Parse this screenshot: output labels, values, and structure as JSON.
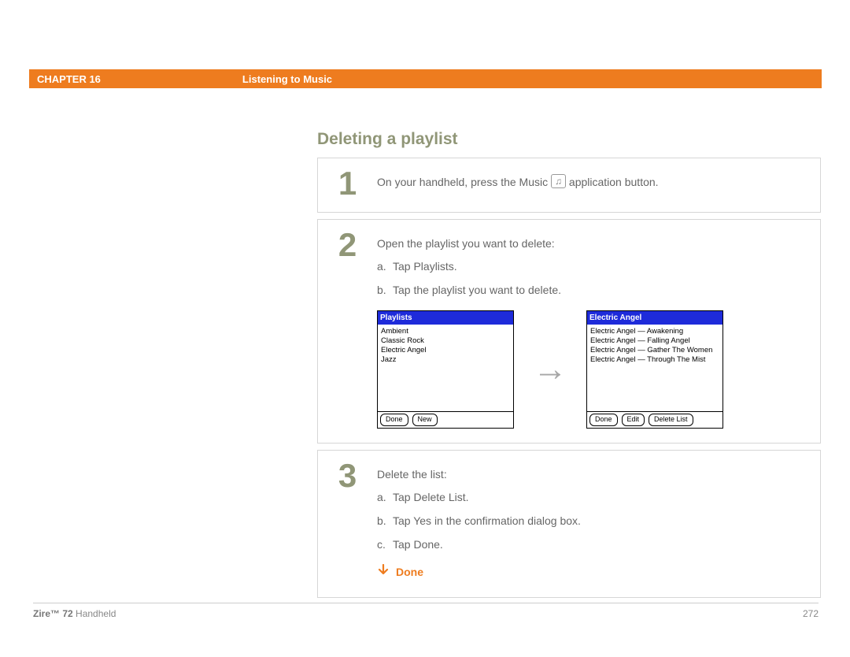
{
  "header": {
    "chapter": "CHAPTER 16",
    "title": "Listening to Music"
  },
  "section_title": "Deleting a playlist",
  "step1": {
    "num": "1",
    "text_before": "On your handheld, press the Music ",
    "text_after": " application button."
  },
  "step2": {
    "num": "2",
    "intro": "Open the playlist you want to delete:",
    "a": "Tap Playlists.",
    "b": "Tap the playlist you want to delete.",
    "screen1": {
      "title": "Playlists",
      "items": [
        "Ambient",
        "Classic Rock",
        "Electric Angel",
        "Jazz"
      ],
      "buttons": [
        "Done",
        "New"
      ]
    },
    "screen2": {
      "title": "Electric Angel",
      "items": [
        "Electric Angel — Awakening",
        "Electric Angel — Falling Angel",
        "Electric Angel — Gather The Women",
        "Electric Angel — Through The Mist"
      ],
      "buttons": [
        "Done",
        "Edit",
        "Delete List"
      ]
    }
  },
  "step3": {
    "num": "3",
    "intro": "Delete the list:",
    "a": "Tap Delete List.",
    "b": "Tap Yes in the confirmation dialog box.",
    "c": "Tap Done.",
    "done": "Done"
  },
  "footer": {
    "product_bold": "Zire™ 72",
    "product_rest": " Handheld",
    "page": "272"
  },
  "letters": {
    "a": "a.",
    "b": "b.",
    "c": "c."
  },
  "arrow": "→",
  "music_glyph": "♫"
}
